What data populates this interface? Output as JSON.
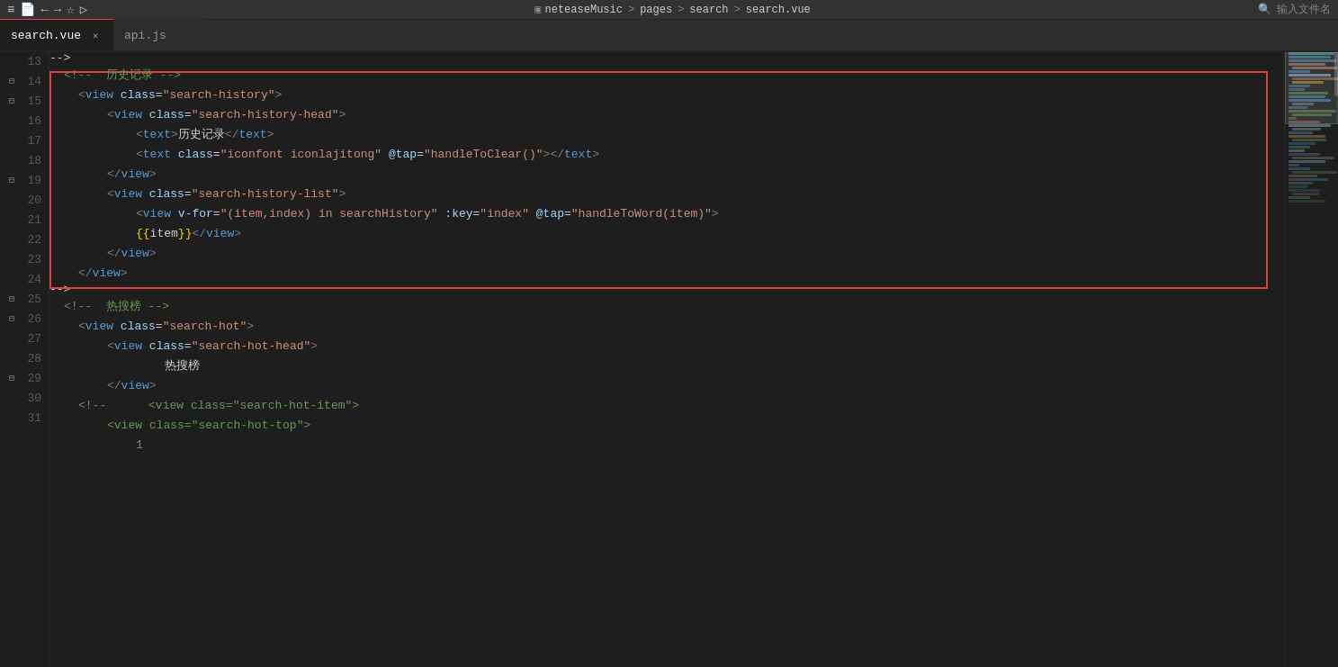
{
  "titleBar": {
    "icons": [
      "←",
      "→",
      "☆",
      "▷"
    ],
    "breadcrumb": [
      "neteaseMusic",
      ">",
      "pages",
      ">",
      "search",
      ">",
      "search.vue"
    ],
    "searchPlaceholder": "输入文件名"
  },
  "tabs": [
    {
      "label": "search.vue",
      "active": true,
      "showClose": true
    },
    {
      "label": "api.js",
      "active": false,
      "showClose": false
    }
  ],
  "lines": [
    {
      "num": 13,
      "fold": false,
      "indent": 0,
      "code": "<!-- 历史记录 -->"
    },
    {
      "num": 14,
      "fold": true,
      "indent": 1,
      "code": "<view class=\"search-history\">"
    },
    {
      "num": 15,
      "fold": true,
      "indent": 2,
      "code": "<view class=\"search-history-head\">"
    },
    {
      "num": 16,
      "fold": false,
      "indent": 3,
      "code": "<text>历史记录</text>"
    },
    {
      "num": 17,
      "fold": false,
      "indent": 3,
      "code": "<text class=\"iconfont iconlajitong\" @tap=\"handleToClear()\"></text>"
    },
    {
      "num": 18,
      "fold": false,
      "indent": 2,
      "code": "</view>"
    },
    {
      "num": 19,
      "fold": true,
      "indent": 2,
      "code": "<view class=\"search-history-list\">"
    },
    {
      "num": 20,
      "fold": false,
      "indent": 3,
      "code": "<view v-for=\"(item,index) in searchHistory\" :key=\"index\" @tap=\"handleToWord(item)\">"
    },
    {
      "num": 21,
      "fold": false,
      "indent": 3,
      "code": "{{item}}</view>"
    },
    {
      "num": 22,
      "fold": false,
      "indent": 2,
      "code": "</view>"
    },
    {
      "num": 23,
      "fold": false,
      "indent": 1,
      "code": "</view>"
    },
    {
      "num": 24,
      "fold": false,
      "indent": 0,
      "code": "<!-- 热搜榜 -->"
    },
    {
      "num": 25,
      "fold": true,
      "indent": 1,
      "code": "<view class=\"search-hot\">"
    },
    {
      "num": 26,
      "fold": true,
      "indent": 2,
      "code": "<view class=\"search-hot-head\">"
    },
    {
      "num": 27,
      "fold": false,
      "indent": 3,
      "code": "热搜榜"
    },
    {
      "num": 28,
      "fold": false,
      "indent": 2,
      "code": "</view>"
    },
    {
      "num": 29,
      "fold": true,
      "indent": 1,
      "code": "<!-- <view class=\"search-hot-item\">"
    },
    {
      "num": 30,
      "fold": false,
      "indent": 2,
      "code": "<view class=\"search-hot-top\">"
    },
    {
      "num": 31,
      "fold": false,
      "indent": 3,
      "code": "1"
    }
  ],
  "colors": {
    "background": "#1e1e1e",
    "tabActive": "#1e1e1e",
    "tabInactive": "#2d2d2d",
    "selectionBorder": "#e04040",
    "lineNumber": "#5a5a5a",
    "comment": "#6a9955",
    "tag": "#569cd6",
    "attr": "#9cdcfe",
    "string": "#ce9178",
    "text": "#d4d4d4"
  }
}
